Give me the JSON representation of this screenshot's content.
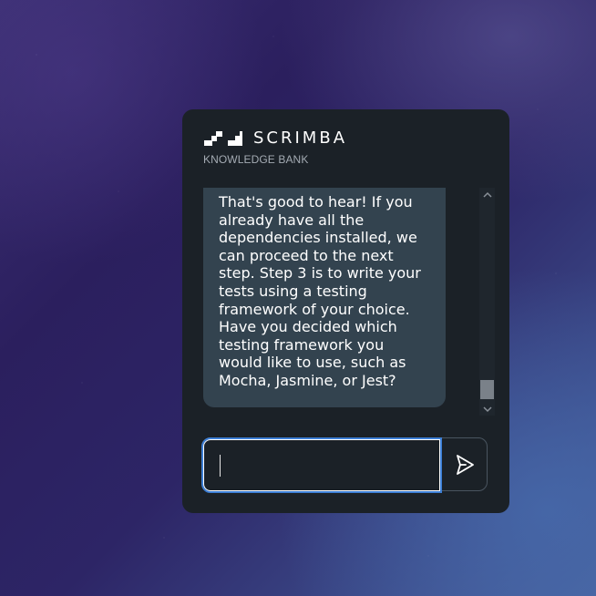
{
  "app": {
    "brand": "SCRIMBA",
    "subtitle": "KNOWLEDGE BANK",
    "logo_icon": "scrimba-logo-mark"
  },
  "conversation": {
    "messages": [
      {
        "role": "assistant",
        "text": "That's good to hear! If you already have all the dependencies installed, we can proceed to the next step. Step 3 is to write your tests using a testing framework of your choice. Have you decided which testing framework you would like to use, such as Mocha, Jasmine, or Jest?"
      }
    ]
  },
  "composer": {
    "value": "",
    "placeholder": "",
    "send_icon": "send-icon"
  },
  "scrollbar": {
    "up_icon": "chevron-up-icon",
    "down_icon": "chevron-down-icon",
    "position_fraction": 1.0
  },
  "colors": {
    "panel": "#1b2127",
    "bubble": "#33434f",
    "focus_ring": "#3d7fd6",
    "text": "#ffffff",
    "muted": "#a4abb3"
  }
}
